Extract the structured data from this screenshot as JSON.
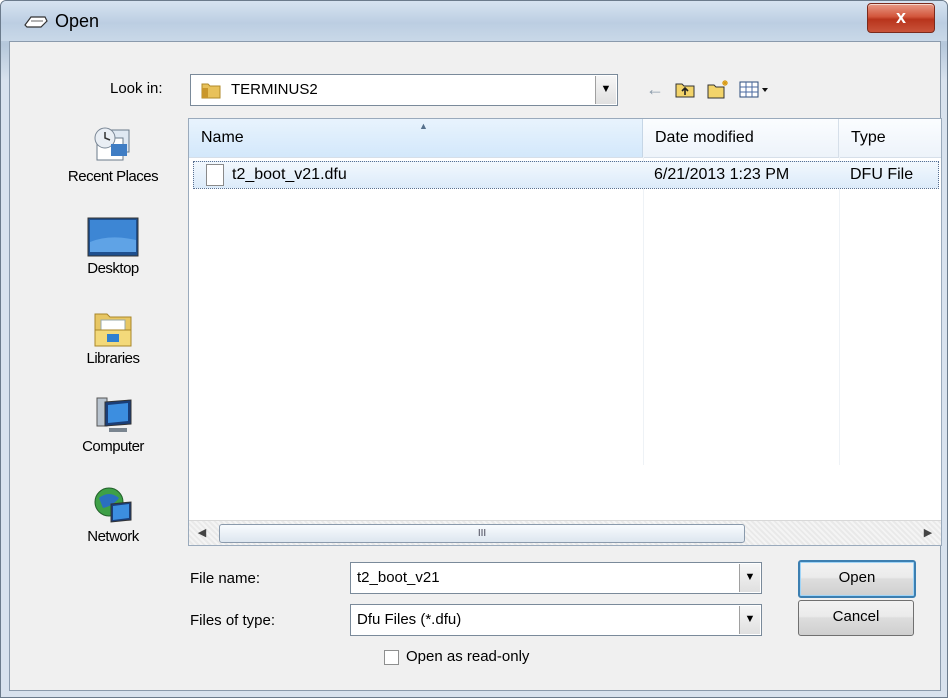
{
  "window": {
    "title": "Open",
    "close_label": "x"
  },
  "look_in": {
    "label": "Look in:",
    "value": "TERMINUS2"
  },
  "toolbar": {
    "back_icon": "back-arrow-icon",
    "up_icon": "up-folder-icon",
    "new_folder_icon": "new-folder-icon",
    "view_menu_icon": "view-menu-icon"
  },
  "places": [
    {
      "label": "Recent Places",
      "icon": "recent-places-icon"
    },
    {
      "label": "Desktop",
      "icon": "desktop-icon"
    },
    {
      "label": "Libraries",
      "icon": "libraries-icon"
    },
    {
      "label": "Computer",
      "icon": "computer-icon"
    },
    {
      "label": "Network",
      "icon": "network-icon"
    }
  ],
  "file_list": {
    "columns": [
      "Name",
      "Date modified",
      "Type"
    ],
    "rows": [
      {
        "name": "t2_boot_v21.dfu",
        "date": "6/21/2013 1:23 PM",
        "type": "DFU File"
      }
    ],
    "scroll_thumb": "III"
  },
  "file_name": {
    "label": "File name:",
    "value": "t2_boot_v21"
  },
  "file_type": {
    "label": "Files of type:",
    "value": "Dfu Files (*.dfu)"
  },
  "buttons": {
    "open": "Open",
    "cancel": "Cancel"
  },
  "read_only": {
    "label": "Open as read-only",
    "checked": false
  },
  "colors": {
    "selection": "#dcebfa",
    "close_button": "#c9533a",
    "default_button_border": "#3c7fb1"
  }
}
